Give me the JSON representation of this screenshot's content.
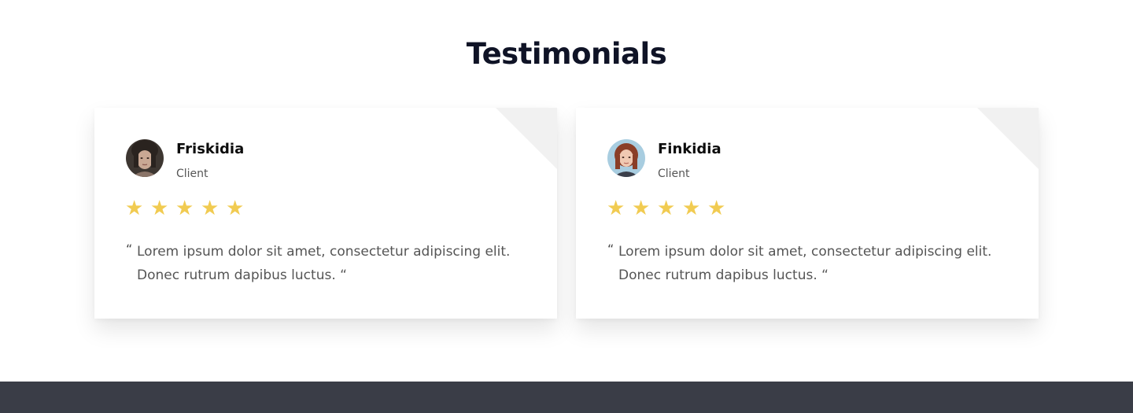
{
  "section": {
    "title": "Testimonials"
  },
  "testimonials": [
    {
      "name": "Friskidia",
      "role": "Client",
      "rating": 5,
      "open_quote": "“",
      "text": "Lorem ipsum dolor sit amet, consectetur adipiscing elit. Donec rutrum dapibus luctus. “"
    },
    {
      "name": "Finkidia",
      "role": "Client",
      "rating": 5,
      "open_quote": "“",
      "text": "Lorem ipsum dolor sit amet, consectetur adipiscing elit. Donec rutrum dapibus luctus. “"
    }
  ],
  "colors": {
    "title": "#0f1326",
    "star": "#f1cb51",
    "footer": "#3a3d47",
    "card_fold": "#f1f1f1"
  },
  "icons": {
    "rating": "star-icon"
  }
}
